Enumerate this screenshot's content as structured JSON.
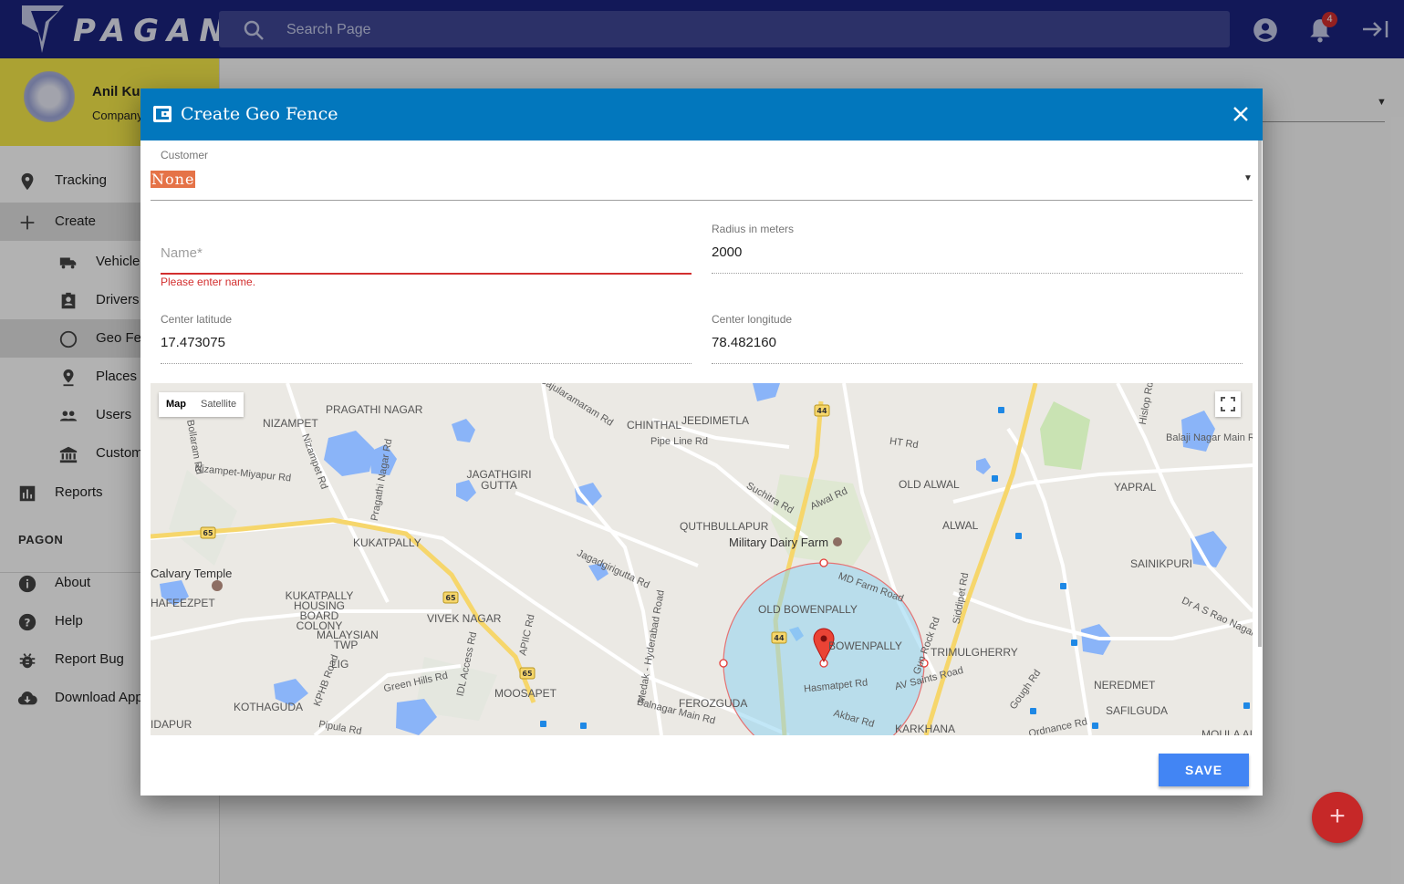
{
  "app": {
    "brand": "PAGAN"
  },
  "topbar": {
    "search_placeholder": "Search Page",
    "notification_count": "4",
    "icons": [
      "search-icon",
      "account-circle-icon",
      "bell-icon",
      "logout-icon"
    ]
  },
  "profile": {
    "name": "Anil Kus",
    "company": "Company"
  },
  "sidebar": {
    "items": [
      {
        "label": "Tracking",
        "icon": "map-pin-icon"
      },
      {
        "label": "Create",
        "icon": "plus-icon"
      },
      {
        "label": "Vehicle",
        "icon": "truck-icon"
      },
      {
        "label": "Drivers",
        "icon": "badge-icon"
      },
      {
        "label": "Geo Fen",
        "icon": "circle-icon"
      },
      {
        "label": "Places",
        "icon": "place-icon"
      },
      {
        "label": "Users",
        "icon": "people-icon"
      },
      {
        "label": "Custom",
        "icon": "bank-icon"
      },
      {
        "label": "Reports",
        "icon": "bar-chart-icon"
      }
    ],
    "section_title": "PAGON",
    "section_items": [
      {
        "label": "About",
        "icon": "info-icon"
      },
      {
        "label": "Help",
        "icon": "help-icon"
      },
      {
        "label": "Report Bug",
        "icon": "bug-icon"
      },
      {
        "label": "Download App",
        "icon": "cloud-download-icon"
      }
    ]
  },
  "dialog": {
    "title": "Create Geo Fence",
    "customer_label": "Customer",
    "customer_value": "None",
    "name_placeholder": "Name*",
    "name_error": "Please enter name.",
    "radius_label": "Radius in meters",
    "radius_value": "2000",
    "lat_label": "Center latitude",
    "lat_value": "17.473075",
    "lng_label": "Center longitude",
    "lng_value": "78.482160",
    "save_label": "SAVE"
  },
  "map": {
    "type_map": "Map",
    "type_satellite": "Satellite",
    "labels": [
      "NIZAMPET",
      "PRAGATHI NAGAR",
      "CHINTHAL",
      "JEEDIMETLA",
      "OLD ALWAL",
      "YAPRAL",
      "JAGATHGIRI GUTTA",
      "QUTHBULLAPUR",
      "ALWAL",
      "KUKATPALLY",
      "Military Dairy Farm",
      "SAINIKPURI",
      "Calvary Temple",
      "HAFEEZPET",
      "KUKATPALLY HOUSING BOARD COLONY",
      "VIVEK NAGAR",
      "OLD BOWENPALLY",
      "BOWENPALLY",
      "TRIMULGHERRY",
      "MALAYSIAN TWP",
      "LIG",
      "MOOSAPET",
      "NEREDMET",
      "KOTHAGUDA",
      "FEROZGUDA",
      "SAFILGUDA",
      "KARKHANA",
      "IDAPUR",
      "MOULA ALI"
    ],
    "roads": [
      "Gajularamaram Rd",
      "Pipe Line Rd",
      "HT Rd",
      "Balaji Nagar Main Rd",
      "Bollaram Rd",
      "Nizampet-Miyapur Rd",
      "Nizampet Rd",
      "Pragathi Nagar Rd",
      "Suchitra Rd",
      "Alwal Rd",
      "Jagadgirigutta Rd",
      "MD Farm Road",
      "Siddipet Rd",
      "Dr A S Rao Nagar Rd",
      "Medak - Hyderabad Road",
      "IDL Access Rd",
      "APIIC Rd",
      "KPHB Road",
      "Green Hills Rd",
      "Balnagar Main Rd",
      "Hasmatpet Rd",
      "AV Saints Road",
      "Gough Rd",
      "Ordnance Rd",
      "Akbar Rd",
      "Pipula Rd",
      "Hislop Rd",
      "Gun Rock Rd"
    ],
    "shields": [
      "44",
      "65"
    ]
  },
  "colors": {
    "topbar": "#1a237e",
    "dialog_header": "#0277bd",
    "save": "#4285f4",
    "fab": "#c62828",
    "error": "#d32f2f",
    "profile_bg": "#f5e94a"
  }
}
